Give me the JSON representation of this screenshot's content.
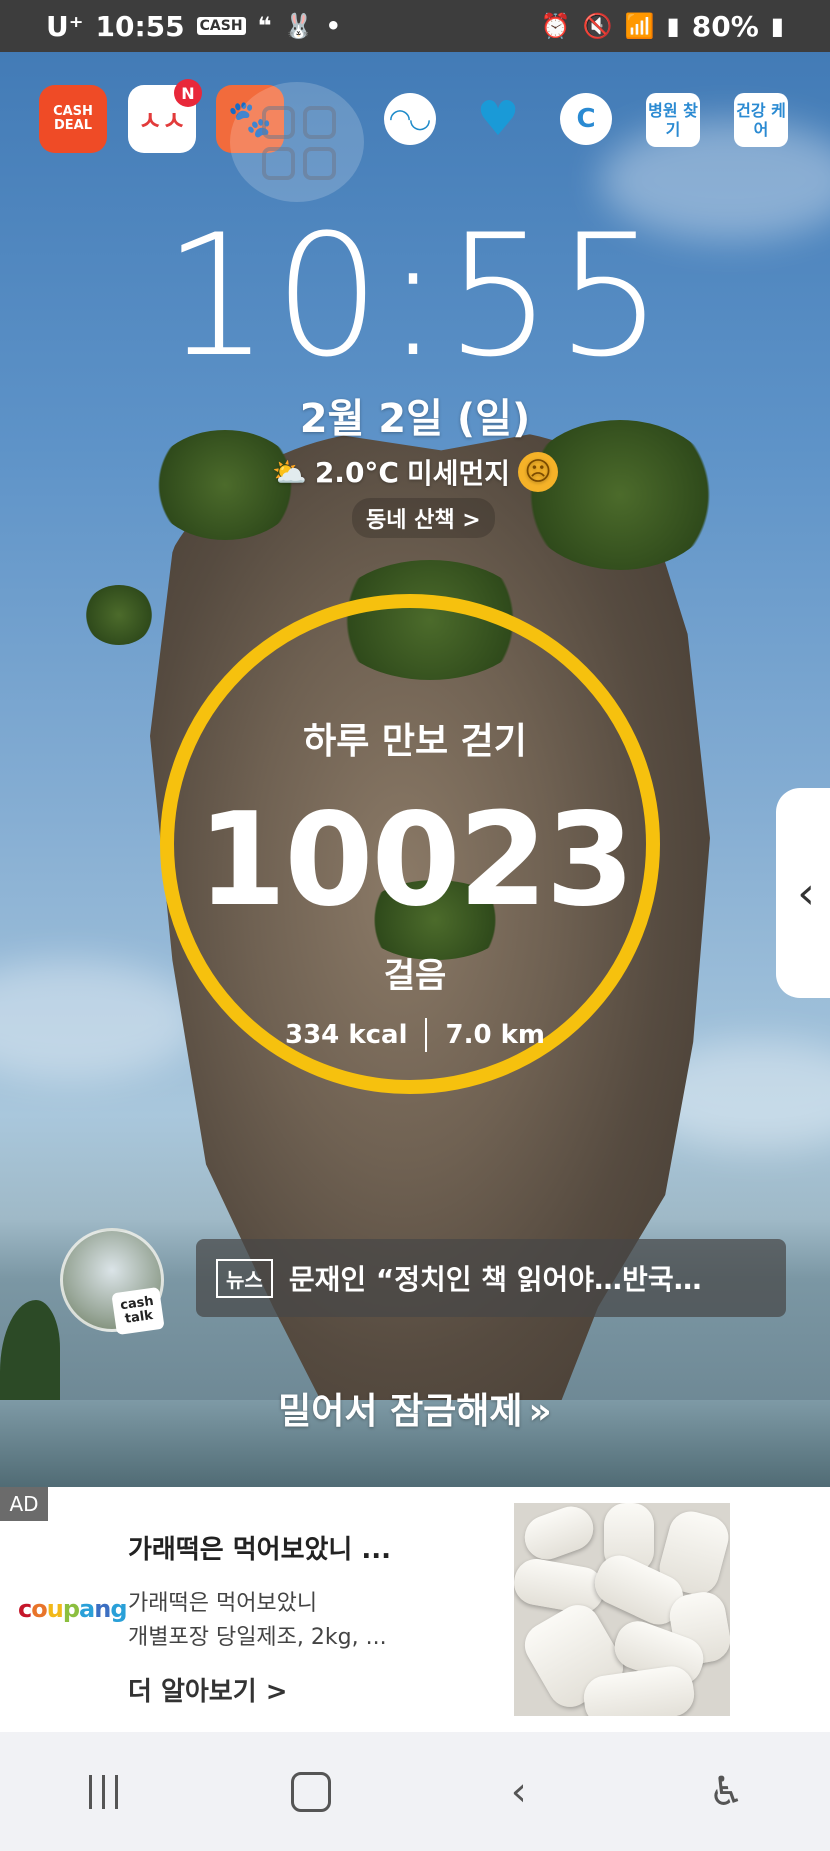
{
  "status_bar": {
    "carrier": "U⁺",
    "time": "10:55",
    "cash_badge": "CASH",
    "battery": "80%"
  },
  "apps": {
    "cash_deal": "CASH DEAL",
    "navi_badge": "N",
    "hospital": "병원 찾기",
    "health_care": "건강 케어"
  },
  "lockscreen": {
    "clock": "10:55",
    "date": "2월 2일 (일)",
    "weather_temp": "2.0°C",
    "weather_dust": "미세먼지",
    "walk_link": "동네 산책 >"
  },
  "step_ring": {
    "title": "하루 만보 걷기",
    "steps": "10023",
    "unit": "걸음",
    "kcal": "334 kcal",
    "distance": "7.0 km"
  },
  "cashtalk": {
    "label": "cash talk"
  },
  "news": {
    "tag": "뉴스",
    "headline": "문재인 “정치인 책 읽어야…반국…"
  },
  "unlock": {
    "label": "밀어서 잠금해제",
    "arrows": "»"
  },
  "ad": {
    "tag": "AD",
    "brand": "coupang",
    "title": "가래떡은 먹어보았니 ...",
    "desc_line1": "가래떡은 먹어보았니",
    "desc_line2": "개별포장 당일제조, 2kg, ...",
    "more": "더 알아보기 >"
  },
  "icons": {
    "weather": "partly-cloudy-icon",
    "dust_face": "sad-face-icon",
    "side_handle": "chevron-left-icon"
  }
}
